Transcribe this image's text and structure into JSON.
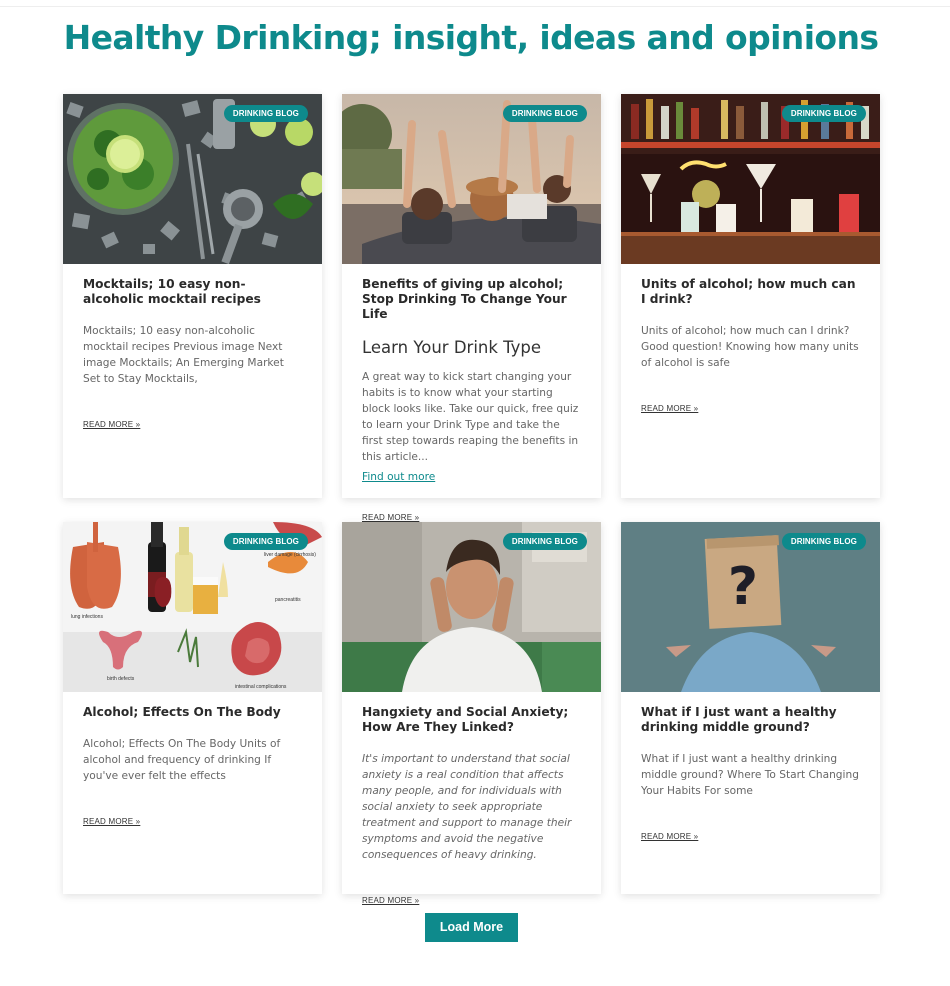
{
  "page": {
    "title": "Healthy Drinking; insight, ideas and opinions"
  },
  "colors": {
    "accent": "#0e8a8c",
    "text": "#2a2a2a",
    "muted": "#666666"
  },
  "cards": [
    {
      "badge": "DRINKING BLOG",
      "image": "mocktail-image",
      "title": "Mocktails; 10 easy non-alcoholic mocktail recipes",
      "excerpt": "Mocktails; 10 easy non-alcoholic mocktail recipes Previous image Next image Mocktails; An Emerging Market Set to Stay Mocktails,",
      "read_more": "READ MORE »"
    },
    {
      "badge": "DRINKING BLOG",
      "image": "convertible-friends-image",
      "title": "Benefits of giving up alcohol; Stop Drinking To Change Your Life",
      "subheading": "Learn Your Drink Type",
      "excerpt": "A great way to kick start changing your habits is to know what your starting block looks like. Take our quick, free quiz to learn your Drink Type and take the first step towards reaping the benefits in this article...",
      "link": "Find out more",
      "read_more": "READ MORE »"
    },
    {
      "badge": "DRINKING BLOG",
      "image": "bar-cocktails-image",
      "title": "Units of alcohol; how much can I drink?",
      "excerpt": "Units of alcohol; how much can I drink? Good question! Knowing how many units of alcohol is safe",
      "read_more": "READ MORE »"
    },
    {
      "badge": "DRINKING BLOG",
      "image": "body-effects-image",
      "image_labels": [
        "liver damage (cirrhosis)",
        "lung infections",
        "pancreatitis",
        "birth defects",
        "intestinal complications"
      ],
      "title": "Alcohol; Effects On The Body",
      "excerpt": "Alcohol; Effects On The Body Units of alcohol and frequency of drinking If you've ever felt the effects",
      "read_more": "READ MORE »"
    },
    {
      "badge": "DRINKING BLOG",
      "image": "anxious-man-image",
      "title": "Hangxiety and Social Anxiety; How Are They Linked?",
      "excerpt": "It's important to understand that social anxiety is a real condition that affects many people, and for individuals with social anxiety to seek appropriate treatment and support to manage their symptoms and avoid the negative consequences of heavy drinking.",
      "read_more": "READ MORE »"
    },
    {
      "badge": "DRINKING BLOG",
      "image": "question-bag-image",
      "title": "What if I just want a healthy drinking middle ground?",
      "excerpt": "What if I just want a healthy drinking middle ground? Where To Start Changing Your Habits For some",
      "read_more": "READ MORE »"
    }
  ],
  "load_more_label": "Load More"
}
